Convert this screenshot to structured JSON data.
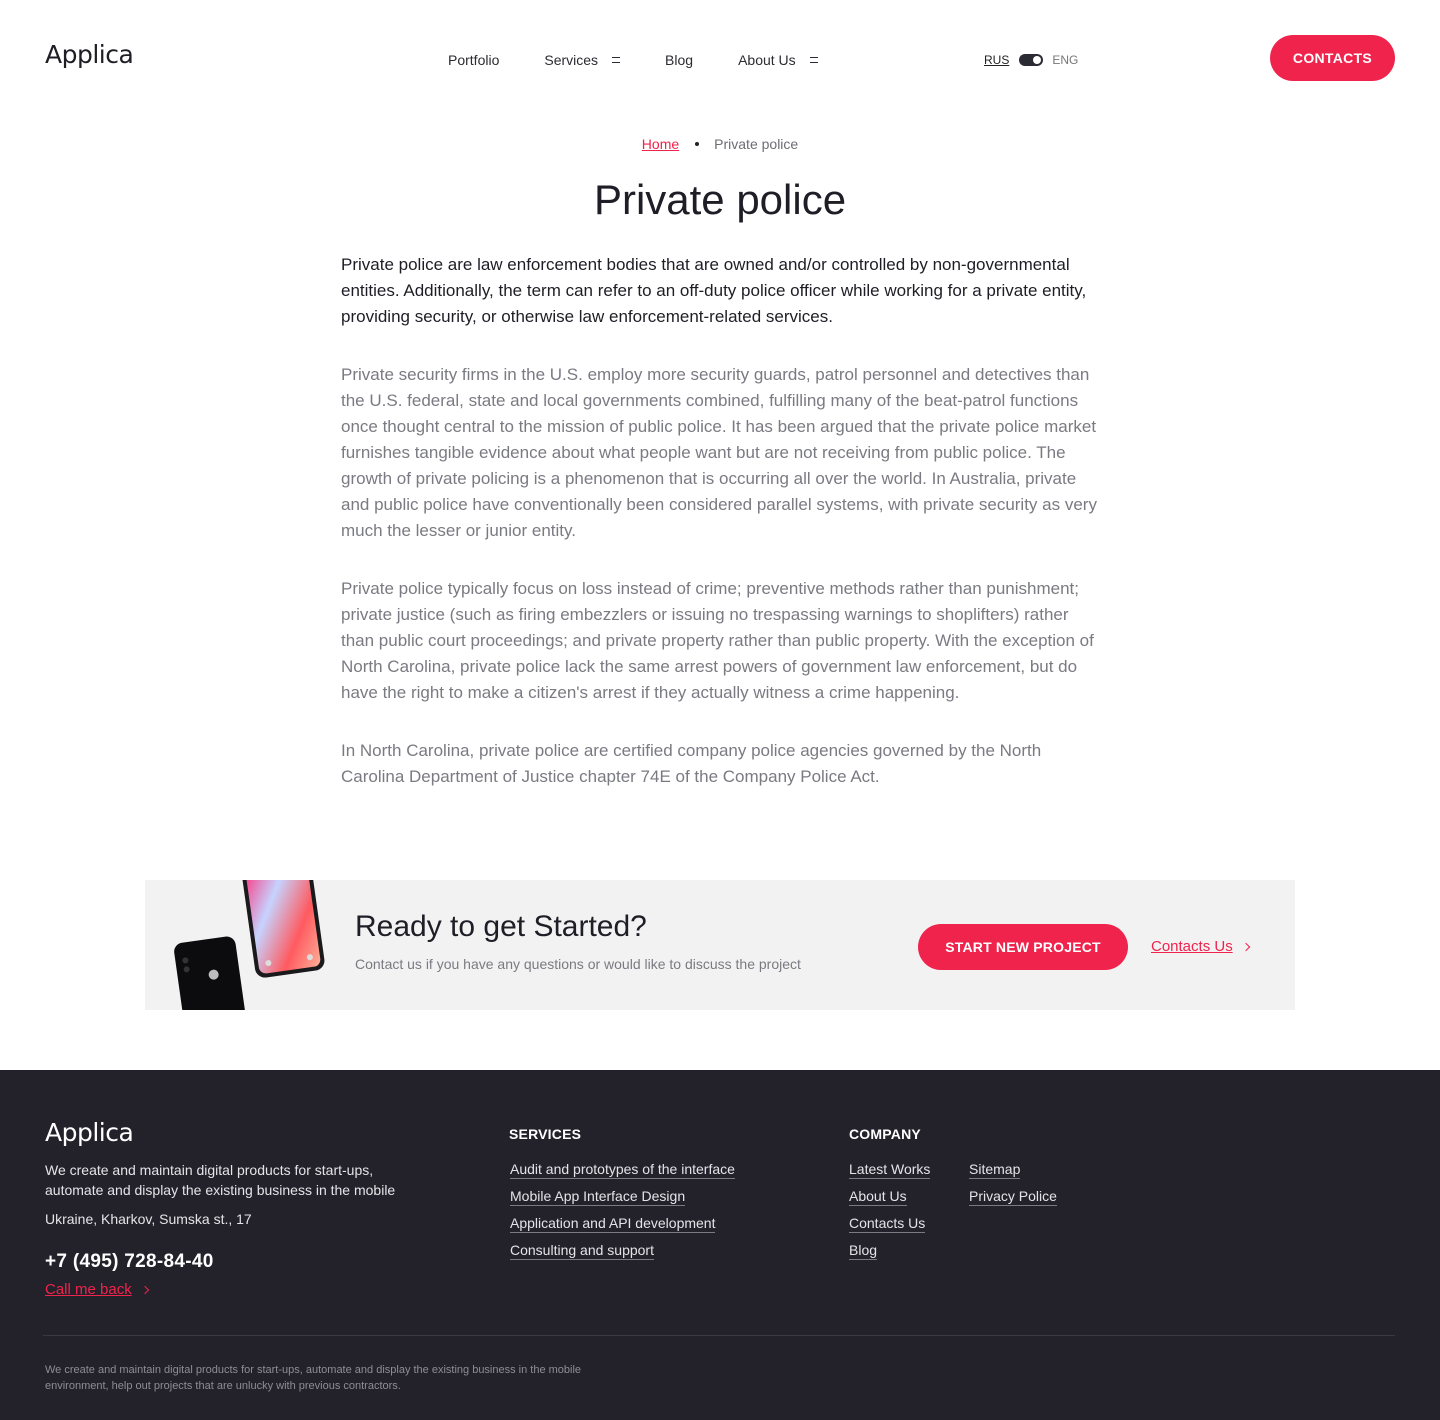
{
  "header": {
    "logo": "Applica",
    "nav": [
      {
        "label": "Portfolio",
        "has_menu": false
      },
      {
        "label": "Services",
        "has_menu": true
      },
      {
        "label": "Blog",
        "has_menu": false
      },
      {
        "label": "About Us",
        "has_menu": true
      }
    ],
    "lang_rus": "RUS",
    "lang_eng": "ENG",
    "contacts_button": "CONTACTS"
  },
  "breadcrumb": {
    "home": "Home",
    "current": "Private police"
  },
  "page": {
    "title": "Private police",
    "lead": "Private police are law enforcement bodies that are owned and/or controlled by non-governmental entities. Additionally, the term can refer to an off-duty police officer while working for a private entity, providing security, or otherwise law enforcement-related services.",
    "paragraphs": [
      "Private security firms in the U.S. employ more security guards, patrol personnel and detectives than the U.S. federal, state and local governments combined, fulfilling many of the beat-patrol functions once thought central to the mission of public police. It has been argued that the private police market furnishes tangible evidence about what people want but are not receiving from public police. The growth of private policing is a phenomenon that is occurring all over the world. In Australia, private and public police have conventionally been considered parallel systems, with private security as very much the lesser or junior entity.",
      "Private police typically focus on loss instead of crime; preventive methods rather than punishment; private justice (such as firing embezzlers or issuing no trespassing warnings to shoplifters) rather than public court proceedings; and private property rather than public property. With the exception of North Carolina, private police lack the same arrest powers of government law enforcement, but do have the right to make a citizen's arrest if they actually witness a crime happening.",
      "In North Carolina, private police are certified company police agencies governed by the North Carolina Department of Justice chapter 74E of the Company Police Act."
    ]
  },
  "cta": {
    "title": "Ready to get Started?",
    "subtitle": "Contact us if you have any questions or would like to discuss the project",
    "start_button": "START NEW PROJECT",
    "contacts_link": "Contacts Us"
  },
  "footer": {
    "logo": "Applica",
    "about": "We create and maintain digital products for start-ups, automate and display the existing business in the mobile",
    "address": "Ukraine, Kharkov, Sumska st., 17",
    "phone": "+7 (495) 728-84-40",
    "callback": "Call me back",
    "services_title": "SERVICES",
    "services": [
      "Audit and prototypes of the interface",
      "Mobile App Interface Design",
      "Application and API development",
      "Consulting and support"
    ],
    "company_title": "COMPANY",
    "company_col1": [
      "Latest Works",
      "About Us",
      "Contacts Us",
      "Blog"
    ],
    "company_col2": [
      "Sitemap",
      "Privacy Police"
    ],
    "bottom_text": "We create and maintain digital products for start-ups, automate and display the existing business in the mobile environment, help out projects that are unlucky with previous contractors."
  },
  "colors": {
    "accent": "#f0234c",
    "footer_bg": "#23222b",
    "cta_bg": "#f2f2f3"
  }
}
